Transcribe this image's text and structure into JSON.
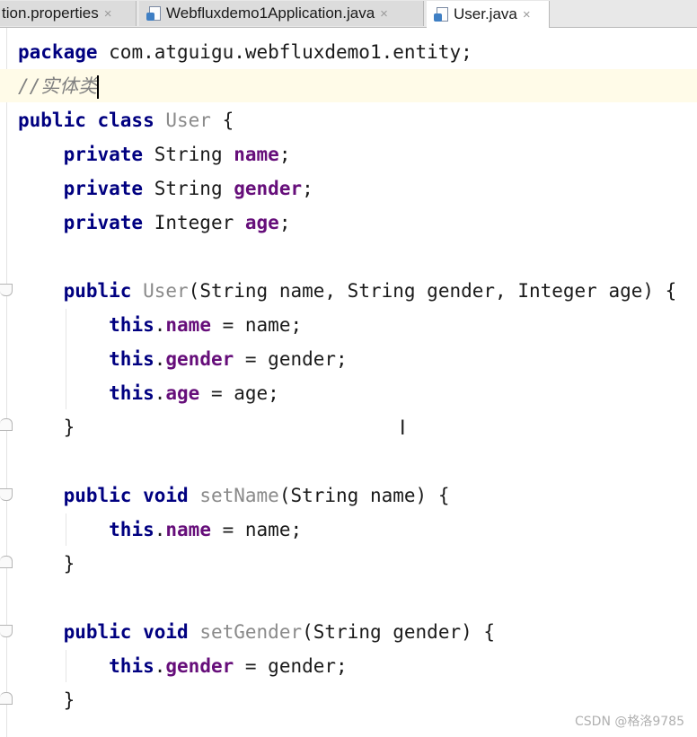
{
  "tabs": [
    {
      "label": "tion.properties",
      "close": "×",
      "icon": "properties-file-icon",
      "active": false
    },
    {
      "label": "Webfluxdemo1Application.java",
      "close": "×",
      "icon": "java-file-icon",
      "active": false
    },
    {
      "label": "User.java",
      "close": "×",
      "icon": "java-file-icon",
      "active": true
    }
  ],
  "editor": {
    "lines": [
      [
        {
          "t": "package",
          "c": "kw"
        },
        {
          "t": " com.atguigu.webfluxdemo1.entity;"
        }
      ],
      [
        {
          "t": "//实体类",
          "c": "cmt"
        },
        {
          "caret": true
        }
      ],
      [
        {
          "t": "public class",
          "c": "kw"
        },
        {
          "t": " "
        },
        {
          "t": "User",
          "c": "decl"
        },
        {
          "t": " {"
        }
      ],
      [
        {
          "t": "    "
        },
        {
          "t": "private",
          "c": "kw"
        },
        {
          "t": " String "
        },
        {
          "t": "name",
          "c": "fld"
        },
        {
          "t": ";"
        }
      ],
      [
        {
          "t": "    "
        },
        {
          "t": "private",
          "c": "kw"
        },
        {
          "t": " String "
        },
        {
          "t": "gender",
          "c": "fld"
        },
        {
          "t": ";"
        }
      ],
      [
        {
          "t": "    "
        },
        {
          "t": "private",
          "c": "kw"
        },
        {
          "t": " Integer "
        },
        {
          "t": "age",
          "c": "fld"
        },
        {
          "t": ";"
        }
      ],
      [],
      [
        {
          "t": "    "
        },
        {
          "t": "public",
          "c": "kw"
        },
        {
          "t": " "
        },
        {
          "t": "User",
          "c": "decl"
        },
        {
          "t": "(String name, String gender, Integer age) {"
        }
      ],
      [
        {
          "t": "        "
        },
        {
          "t": "this",
          "c": "kw"
        },
        {
          "t": "."
        },
        {
          "t": "name",
          "c": "fld"
        },
        {
          "t": " = name;"
        }
      ],
      [
        {
          "t": "        "
        },
        {
          "t": "this",
          "c": "kw"
        },
        {
          "t": "."
        },
        {
          "t": "gender",
          "c": "fld"
        },
        {
          "t": " = gender;"
        }
      ],
      [
        {
          "t": "        "
        },
        {
          "t": "this",
          "c": "kw"
        },
        {
          "t": "."
        },
        {
          "t": "age",
          "c": "fld"
        },
        {
          "t": " = age;"
        }
      ],
      [
        {
          "t": "    }"
        }
      ],
      [],
      [
        {
          "t": "    "
        },
        {
          "t": "public void",
          "c": "kw"
        },
        {
          "t": " "
        },
        {
          "t": "setName",
          "c": "decl"
        },
        {
          "t": "(String name) {"
        }
      ],
      [
        {
          "t": "        "
        },
        {
          "t": "this",
          "c": "kw"
        },
        {
          "t": "."
        },
        {
          "t": "name",
          "c": "fld"
        },
        {
          "t": " = name;"
        }
      ],
      [
        {
          "t": "    }"
        }
      ],
      [],
      [
        {
          "t": "    "
        },
        {
          "t": "public void",
          "c": "kw"
        },
        {
          "t": " "
        },
        {
          "t": "setGender",
          "c": "decl"
        },
        {
          "t": "(String gender) {"
        }
      ],
      [
        {
          "t": "        "
        },
        {
          "t": "this",
          "c": "kw"
        },
        {
          "t": "."
        },
        {
          "t": "gender",
          "c": "fld"
        },
        {
          "t": " = gender;"
        }
      ],
      [
        {
          "t": "    }"
        }
      ]
    ]
  },
  "watermark": "CSDN @格洛9785",
  "colors": {
    "keyword": "#000080",
    "field": "#660e7a",
    "comment": "#808080",
    "current_line": "#fffbe8"
  }
}
